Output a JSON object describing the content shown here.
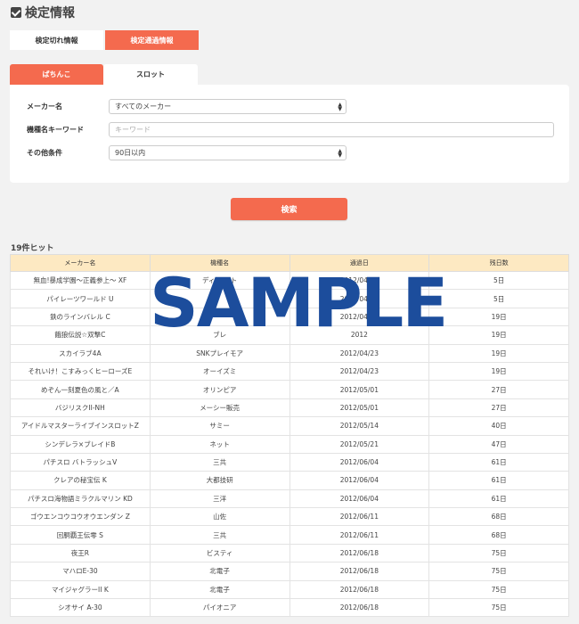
{
  "header": {
    "title": "検定情報"
  },
  "top_tabs": [
    {
      "label": "検定切れ情報",
      "active": false
    },
    {
      "label": "検定通過情報",
      "active": true
    }
  ],
  "category_tabs": [
    {
      "label": "ぱちんこ",
      "active": true
    },
    {
      "label": "スロット",
      "active": false
    }
  ],
  "form": {
    "maker_label": "メーカー名",
    "maker_value": "すべてのメーカー",
    "keyword_label": "機種名キーワード",
    "keyword_placeholder": "キーワード",
    "other_label": "その他条件",
    "other_value": "90日以内"
  },
  "search_button": "検索",
  "hit_count": "19件ヒット",
  "table": {
    "headers": [
      "メーカー名",
      "機種名",
      "通過日",
      "残日数"
    ],
    "rows": [
      [
        "無血!暴成学園〜正義参上〜 XF",
        "ディ ライト",
        "2012/04/09",
        "5日"
      ],
      [
        "パイレーツワールド U",
        "",
        "2012/04/09",
        "5日"
      ],
      [
        "鉄のラインバレル C",
        "",
        "2012/04/23",
        "19日"
      ],
      [
        "餓狼伝説☆双撃C",
        "ブレ",
        "2012",
        "19日"
      ],
      [
        "スカイラブ4A",
        "SNKプレイモア",
        "2012/04/23",
        "19日"
      ],
      [
        "それいけ！こすみっくヒーローズE",
        "オーイズミ",
        "2012/04/23",
        "19日"
      ],
      [
        "めぞん一刻夏色の風と／A",
        "オリンピア",
        "2012/05/01",
        "27日"
      ],
      [
        "バジリスクII-NH",
        "メーシー販売",
        "2012/05/01",
        "27日"
      ],
      [
        "アイドルマスターライブインスロットZ",
        "サミー",
        "2012/05/14",
        "40日"
      ],
      [
        "シンデレラ×ブレイドB",
        "ネット",
        "2012/05/21",
        "47日"
      ],
      [
        "パチスロ バトラッシュV",
        "三共",
        "2012/06/04",
        "61日"
      ],
      [
        "クレアの秘宝伝 K",
        "大都技研",
        "2012/06/04",
        "61日"
      ],
      [
        "パチスロ海物語ミラクルマリン KD",
        "三洋",
        "2012/06/04",
        "61日"
      ],
      [
        "ゴウエンコウコウオウエンダン Z",
        "山佐",
        "2012/06/11",
        "68日"
      ],
      [
        "回胴覇王伝零 S",
        "三共",
        "2012/06/11",
        "68日"
      ],
      [
        "夜王R",
        "ビスティ",
        "2012/06/18",
        "75日"
      ],
      [
        "マハロE-30",
        "北電子",
        "2012/06/18",
        "75日"
      ],
      [
        "マイジャグラーII K",
        "北電子",
        "2012/06/18",
        "75日"
      ],
      [
        "シオサイ A-30",
        "パイオニア",
        "2012/06/18",
        "75日"
      ]
    ]
  },
  "watermark": "SAMPLE"
}
